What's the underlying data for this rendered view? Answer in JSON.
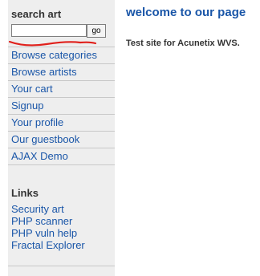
{
  "sidebar": {
    "search": {
      "title": "search art",
      "input_value": "",
      "button_label": "go",
      "annotation_color": "#e0201b"
    },
    "nav_items": [
      {
        "label": "Browse categories"
      },
      {
        "label": "Browse artists"
      },
      {
        "label": "Your cart"
      },
      {
        "label": "Signup"
      },
      {
        "label": "Your profile"
      },
      {
        "label": "Our guestbook"
      },
      {
        "label": "AJAX Demo"
      }
    ],
    "links": {
      "title": "Links",
      "items": [
        {
          "label": "Security art"
        },
        {
          "label": "PHP scanner"
        },
        {
          "label": "PHP vuln help"
        },
        {
          "label": "Fractal Explorer"
        }
      ]
    }
  },
  "main": {
    "title": "welcome to our page",
    "text": "Test site for Acunetix WVS."
  },
  "colors": {
    "link": "#1a56a8",
    "sidebar_bg": "#eeeeee"
  }
}
